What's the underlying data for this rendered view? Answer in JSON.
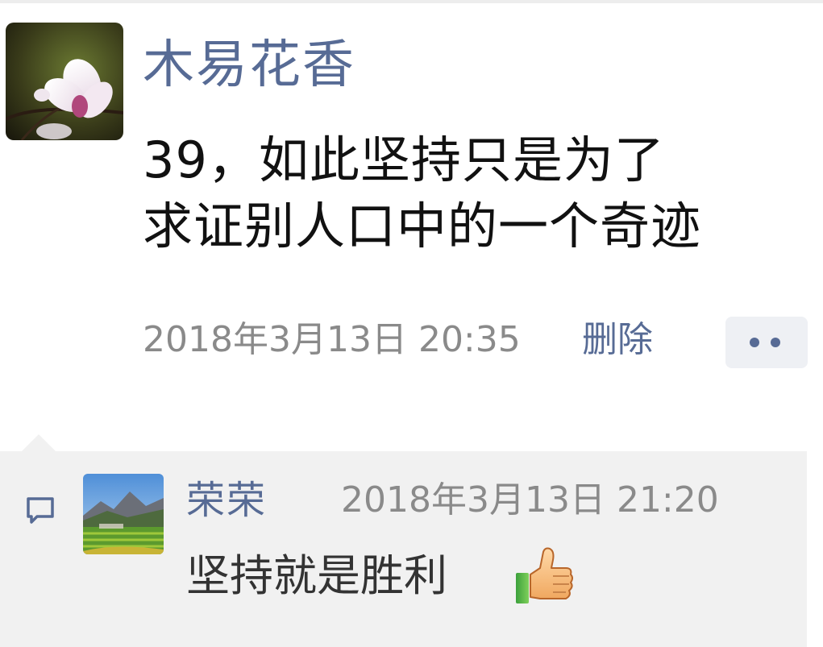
{
  "post": {
    "author": "木易花香",
    "content_lines": [
      "39，如此坚持只是为了",
      "求证别人口中的一个奇迹"
    ],
    "time": "2018年3月13日 20:35",
    "delete_label": "删除"
  },
  "comment": {
    "author": "荣荣",
    "time": "2018年3月13日 21:20",
    "text": "坚持就是胜利"
  },
  "icons": {
    "comment": "comment-bubble-icon",
    "emoji": "thumbs-up-icon",
    "more": "more-dots-icon"
  },
  "colors": {
    "link": "#576b95",
    "meta": "#8a8a8a",
    "text": "#111111",
    "comment_bg": "#f1f1f1"
  }
}
